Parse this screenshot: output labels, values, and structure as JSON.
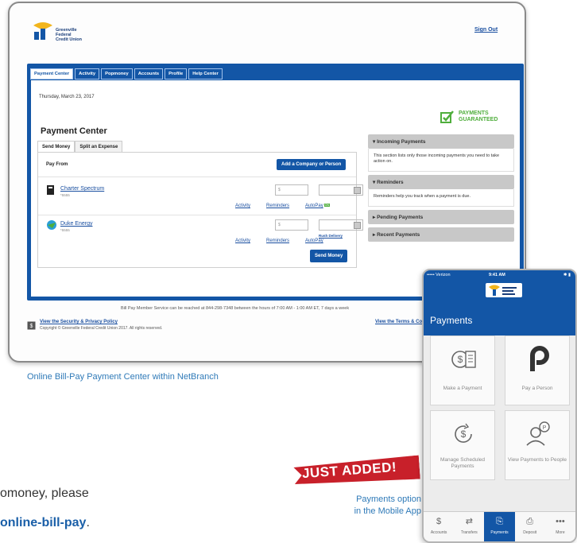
{
  "brand": {
    "name_lines": [
      "Greenville",
      "Federal",
      "Credit Union"
    ],
    "primary_color": "#1356a6",
    "accent_green": "#4fae3c",
    "accent_red": "#c8202a"
  },
  "header": {
    "sign_out": "Sign Out"
  },
  "top_tabs": [
    "Payment Center",
    "Activity",
    "Popmoney",
    "Accounts",
    "Profile",
    "Help Center"
  ],
  "page": {
    "date": "Thursday, March 23, 2017",
    "title": "Payment Center",
    "guarantee_line1": "PAYMENTS",
    "guarantee_line2": "GUARANTEED"
  },
  "subtabs": [
    "Send Money",
    "Split an Expense"
  ],
  "payments": {
    "pay_from_label": "Pay From",
    "add_button": "Add a Company or Person",
    "payees": [
      {
        "name": "Charter Spectrum",
        "sub": "*5555",
        "amount_placeholder": "$",
        "links": [
          "Activity",
          "Reminders",
          "AutoPay"
        ],
        "autopay_badge": "ON",
        "rush": ""
      },
      {
        "name": "Duke Energy",
        "sub": "*5555",
        "amount_placeholder": "$",
        "links": [
          "Activity",
          "Reminders",
          "AutoPay"
        ],
        "autopay_badge": "",
        "rush": "Rush Delivery"
      }
    ],
    "send_button": "Send Money"
  },
  "side_panel": [
    {
      "title": "Incoming Payments",
      "arrow": "▾",
      "body": "This section lists only those incoming payments you need to take action on."
    },
    {
      "title": "Reminders",
      "arrow": "▾",
      "body": "Reminders help you track when a payment is due."
    },
    {
      "title": "Pending Payments",
      "arrow": "▸",
      "body": ""
    },
    {
      "title": "Recent Payments",
      "arrow": "▸",
      "body": ""
    }
  ],
  "footer": {
    "note": "Bill Pay Member Service can be reached at 844-298-7348 between the hours of 7:00 AM - 1:00 AM ET, 7 days a week",
    "security_link": "View the Security & Privacy Policy",
    "copyright": "Copyright © Greenville Federal Credit Union 2017. All rights reserved.",
    "terms_link": "View the Terms & Co"
  },
  "captions": {
    "desktop": "Online Bill-Pay Payment Center within NetBranch",
    "mobile_line1": "Payments option",
    "mobile_line2": "in the Mobile App",
    "banner": "JUST ADDED!"
  },
  "body_text": {
    "line1": "omoney, please",
    "line2_bold": "online-bill-pay",
    "line2_end": "."
  },
  "phone": {
    "carrier": "••••• Verizon",
    "time": "9:41 AM",
    "status_right": "✱ ▮",
    "title": "Payments",
    "tiles": [
      {
        "label": "Make a Payment",
        "icon": "payment-doc-icon"
      },
      {
        "label": "Pay a Person",
        "icon": "popmoney-p-icon"
      },
      {
        "label": "Manage Scheduled Payments",
        "icon": "scheduled-dollar-icon"
      },
      {
        "label": "View Payments to People",
        "icon": "person-payment-icon"
      }
    ],
    "tabbar": [
      {
        "label": "Accounts",
        "icon": "$"
      },
      {
        "label": "Transfers",
        "icon": "⇄"
      },
      {
        "label": "Payments",
        "icon": "⎘"
      },
      {
        "label": "Deposit",
        "icon": "⎙"
      },
      {
        "label": "More",
        "icon": "•••"
      }
    ]
  }
}
